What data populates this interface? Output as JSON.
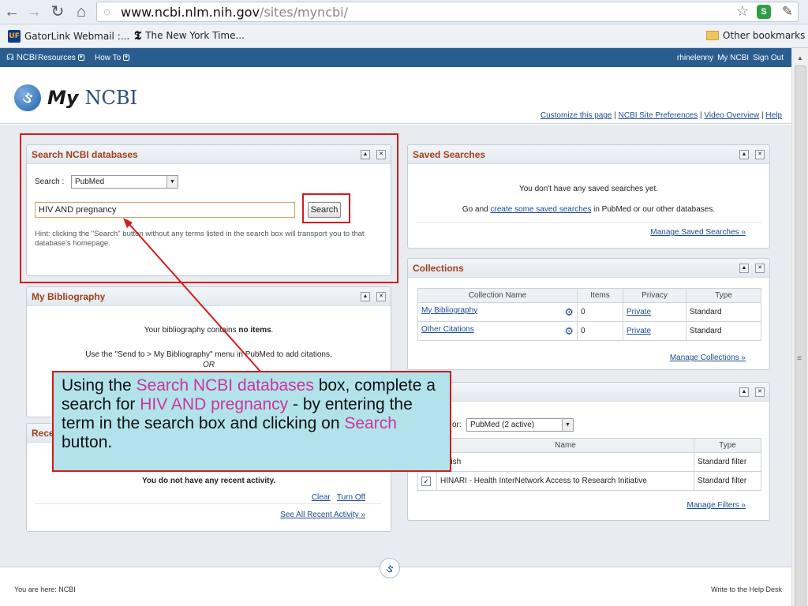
{
  "browser": {
    "url_host": "www.ncbi.nlm.nih.gov",
    "url_path": "/sites/myncbi/",
    "bookmarks": [
      "GatorLink Webmail :...",
      "The New York Time..."
    ],
    "other_bookmarks": "Other bookmarks",
    "uf_badge": "UF"
  },
  "ncbi_bar": {
    "logo": "NCBI",
    "resources": "Resources",
    "howto": "How To",
    "user": "rhinelenny",
    "my_ncbi": "My NCBI",
    "sign_out": "Sign Out"
  },
  "header": {
    "logo_my": "My",
    "logo_ncbi": "NCBI",
    "links": [
      "Customize this page",
      "NCBI Site Preferences",
      "Video Overview",
      "Help"
    ]
  },
  "search_panel": {
    "title": "Search NCBI databases",
    "search_label": "Search :",
    "database": "PubMed",
    "query": "HIV AND pregnancy",
    "button": "Search",
    "hint": "Hint: clicking the \"Search\" button without any terms listed in the search box will transport you to that database's homepage."
  },
  "bibliography_panel": {
    "title": "My Bibliography",
    "line1_pre": "Your bibliography contains ",
    "line1_bold": "no items",
    "line1_post": ".",
    "line2": "Use the \"Send to > My Bibliography\" menu in PubMed to add citations,",
    "line3": "OR"
  },
  "recent_panel": {
    "title": "Rece",
    "empty": "You do not have any recent activity.",
    "clear": "Clear",
    "turn_off": "Turn Off",
    "see_all": "See All Recent Activity »"
  },
  "saved_panel": {
    "title": "Saved Searches",
    "line1": "You don't have any saved searches yet.",
    "line2_pre": "Go and ",
    "line2_link": "create some saved searches",
    "line2_post": " in PubMed or our other databases.",
    "manage": "Manage Saved Searches »"
  },
  "collections_panel": {
    "title": "Collections",
    "headers": [
      "Collection Name",
      "Items",
      "Privacy",
      "Type"
    ],
    "rows": [
      {
        "name": "My Bibliography",
        "items": "0",
        "privacy": "Private",
        "type": "Standard"
      },
      {
        "name": "Other Citations",
        "items": "0",
        "privacy": "Private",
        "type": "Standard"
      }
    ],
    "manage": "Manage Collections »"
  },
  "filters_panel": {
    "for_label": "or:",
    "select": "PubMed (2 active)",
    "headers": [
      "Name",
      "Type"
    ],
    "rows": [
      {
        "name": "nglish",
        "type": "Standard filter",
        "checked": ""
      },
      {
        "name": "HINARI - Health InterNetwork Access to Research Initiative",
        "type": "Standard filter",
        "checked": "✓"
      }
    ],
    "manage": "Manage Filters »"
  },
  "callout": {
    "p1": "Using the ",
    "h1": "Search NCBI databases",
    "p2": " box, complete a search for ",
    "h2": "HIV AND pregnancy",
    "p3": " - by entering the term in the search box and clicking on ",
    "h3": "Search",
    "p4": " button."
  },
  "footer": {
    "you_are_here": "You are here: NCBI",
    "help_desk": "Write to the Help Desk"
  },
  "colors": {
    "annotation_red": "#d31b1b",
    "callout_bg": "#b3e3ea",
    "highlight_pink": "#c9359c",
    "ncbi_blue": "#2a5d8f"
  }
}
